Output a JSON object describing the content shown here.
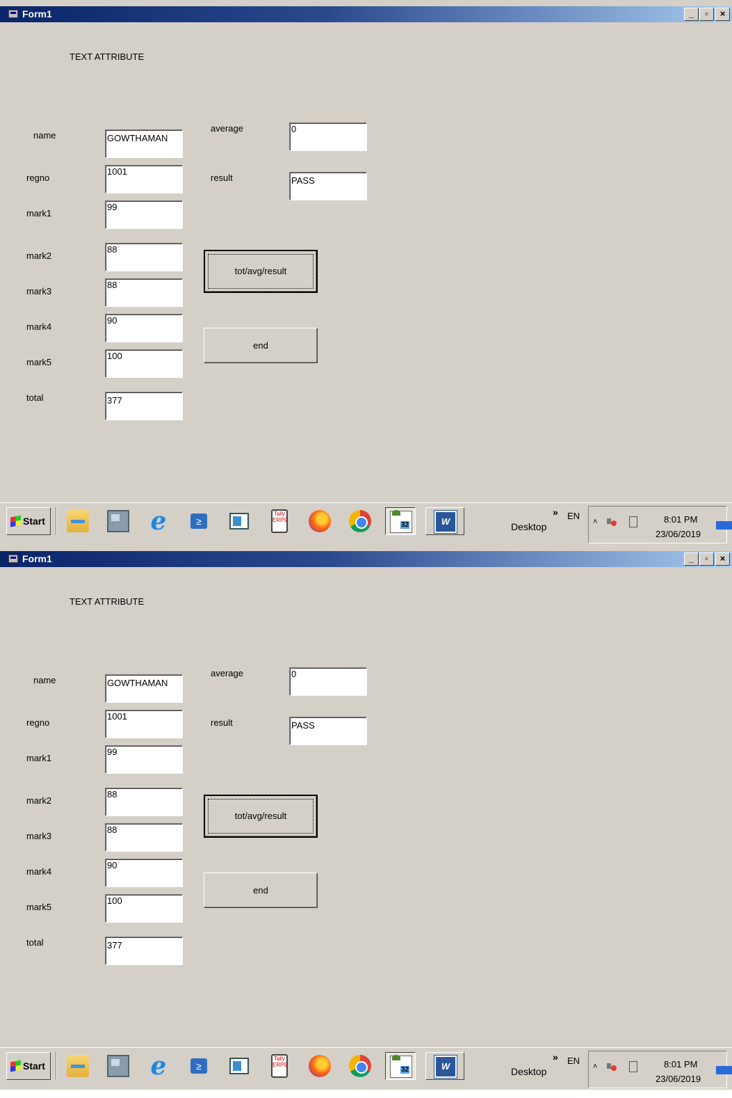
{
  "window": {
    "title": "Form1",
    "min_glyph": "_",
    "max_glyph": "▫",
    "close_glyph": "×"
  },
  "form": {
    "heading": "TEXT ATTRIBUTE",
    "labels": {
      "name": "name",
      "regno": "regno",
      "mark1": "mark1",
      "mark2": "mark2",
      "mark3": "mark3",
      "mark4": "mark4",
      "mark5": "mark5",
      "total": "total",
      "average": "average",
      "result": "result"
    },
    "values": {
      "name": "GOWTHAMAN",
      "regno": "1001",
      "mark1": "99",
      "mark2": "88",
      "mark3": "88",
      "mark4": "90",
      "mark5": "100",
      "total": "377",
      "average": "0",
      "result": "PASS"
    },
    "buttons": {
      "calc": "tot/avg/result",
      "end": "end"
    }
  },
  "taskbar": {
    "start": "Start",
    "tally_text": "Tally ERP9",
    "powershell_glyph": "≥",
    "ie_glyph": "e",
    "word_glyph": "W",
    "desktop": "Desktop",
    "chevron": "»",
    "lang": "EN",
    "tray_up": "˄",
    "time": "8:01 PM",
    "date": "23/06/2019"
  }
}
